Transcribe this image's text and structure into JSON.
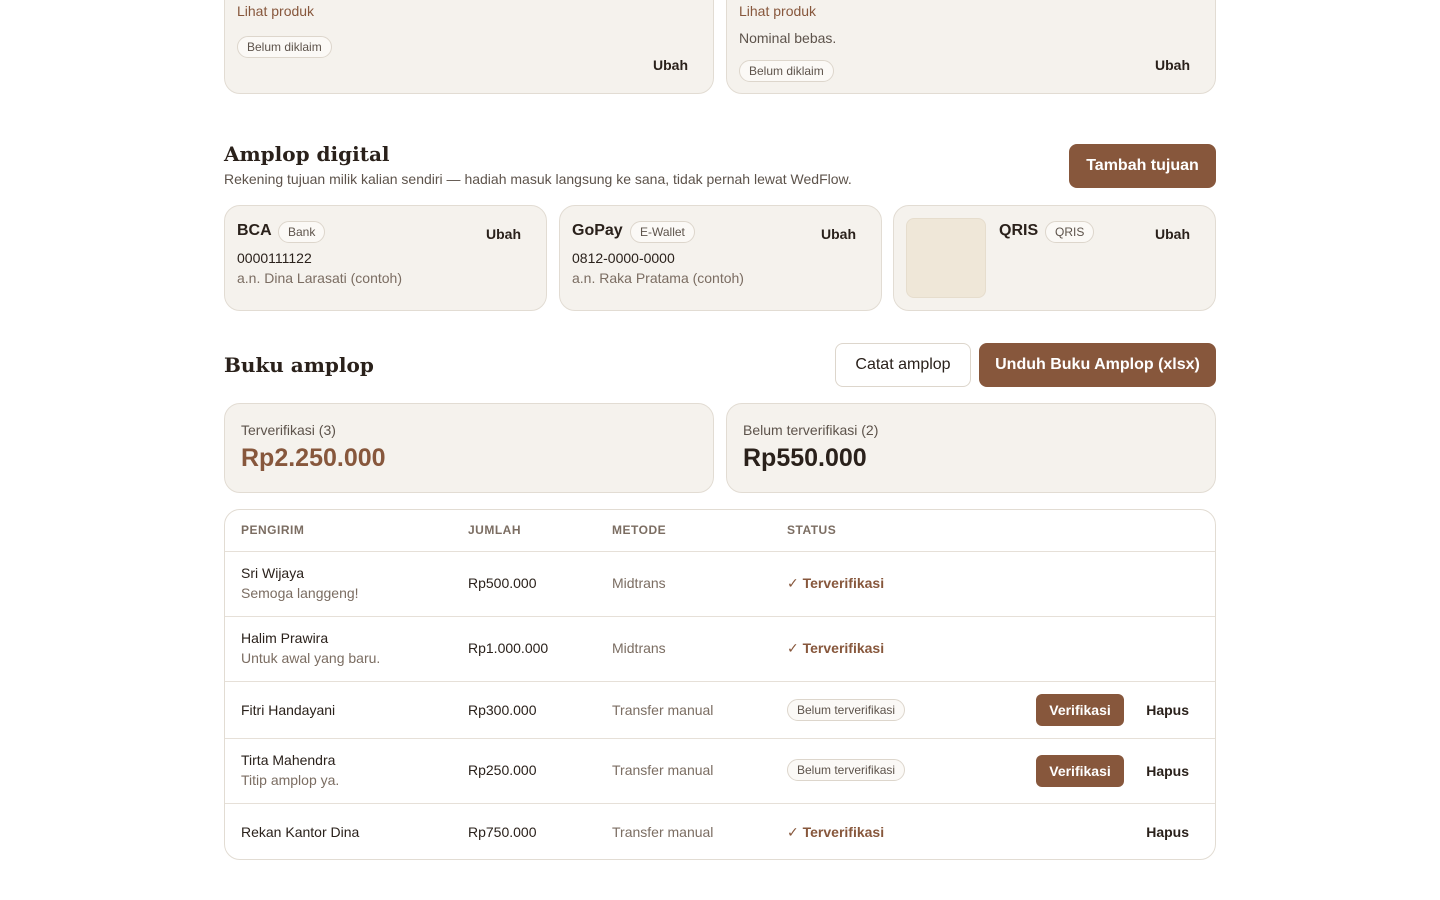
{
  "products": [
    {
      "link": "Lihat produk",
      "note": "",
      "badge": "Belum diklaim",
      "edit": "Ubah"
    },
    {
      "link": "Lihat produk",
      "note": "Nominal bebas.",
      "badge": "Belum diklaim",
      "edit": "Ubah"
    }
  ],
  "amplop": {
    "title": "Amplop digital",
    "subtitle": "Rekening tujuan milik kalian sendiri — hadiah masuk langsung ke sana, tidak pernah lewat WedFlow.",
    "add_button": "Tambah tujuan",
    "accounts": [
      {
        "name": "BCA",
        "type": "Bank",
        "number": "0000111122",
        "holder": "a.n. Dina Larasati (contoh)",
        "edit": "Ubah"
      },
      {
        "name": "GoPay",
        "type": "E-Wallet",
        "number": "0812-0000-0000",
        "holder": "a.n. Raka Pratama (contoh)",
        "edit": "Ubah"
      },
      {
        "name": "QRIS",
        "type": "QRIS",
        "edit": "Ubah"
      }
    ]
  },
  "buku": {
    "title": "Buku amplop",
    "record_button": "Catat amplop",
    "download_button": "Unduh Buku Amplop (xlsx)",
    "verified": {
      "label": "Terverifikasi (3)",
      "amount": "Rp2.250.000"
    },
    "unverified": {
      "label": "Belum terverifikasi (2)",
      "amount": "Rp550.000"
    }
  },
  "table": {
    "headers": [
      "PENGIRIM",
      "JUMLAH",
      "METODE",
      "STATUS"
    ],
    "rows": [
      {
        "sender": "Sri Wijaya",
        "message": "Semoga langgeng!",
        "amount": "Rp500.000",
        "method": "Midtrans",
        "status": "✓ Terverifikasi",
        "verified": true
      },
      {
        "sender": "Halim Prawira",
        "message": "Untuk awal yang baru.",
        "amount": "Rp1.000.000",
        "method": "Midtrans",
        "status": "✓ Terverifikasi",
        "verified": true
      },
      {
        "sender": "Fitri Handayani",
        "message": "",
        "amount": "Rp300.000",
        "method": "Transfer manual",
        "status": "Belum terverifikasi",
        "verified": false,
        "verify_label": "Verifikasi",
        "delete_label": "Hapus"
      },
      {
        "sender": "Tirta Mahendra",
        "message": "Titip amplop ya.",
        "amount": "Rp250.000",
        "method": "Transfer manual",
        "status": "Belum terverifikasi",
        "verified": false,
        "verify_label": "Verifikasi",
        "delete_label": "Hapus"
      },
      {
        "sender": "Rekan Kantor Dina",
        "message": "",
        "amount": "Rp750.000",
        "method": "Transfer manual",
        "status": "✓ Terverifikasi",
        "verified": true,
        "delete_label": "Hapus"
      }
    ]
  },
  "colors": {
    "accent": "#87573c",
    "card": "#f5f2ed",
    "border": "#e2dcd3"
  }
}
